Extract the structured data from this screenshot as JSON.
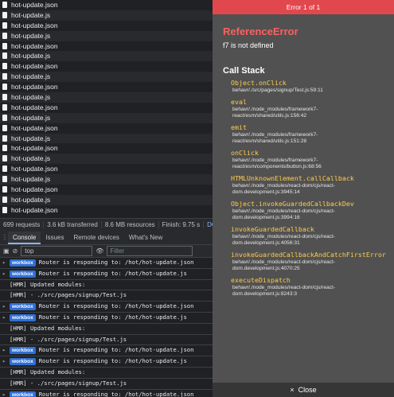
{
  "network": {
    "rows": [
      "hot-update.json",
      "hot-update.js",
      "hot-update.json",
      "hot-update.js",
      "hot-update.json",
      "hot-update.js",
      "hot-update.json",
      "hot-update.js",
      "hot-update.json",
      "hot-update.js",
      "hot-update.json",
      "hot-update.js",
      "hot-update.json",
      "hot-update.js",
      "hot-update.json",
      "hot-update.js",
      "hot-update.json",
      "hot-update.js",
      "hot-update.json",
      "hot-update.js",
      "hot-update.json"
    ],
    "status": {
      "requests": "699 requests",
      "transferred": "3.6 kB transferred",
      "resources": "8.6 MB resources",
      "finish": "Finish: 9.75 s",
      "dom": "DOM"
    }
  },
  "drawer": {
    "tabs": [
      "Console",
      "Issues",
      "Remote devices",
      "What's New"
    ],
    "active_tab": "Console"
  },
  "toolbar": {
    "context": "top",
    "filter_placeholder": "Filter"
  },
  "console": {
    "badge": "workbox",
    "rows": [
      {
        "type": "workbox",
        "text": "Router is responding to: /hot/hot-update.json"
      },
      {
        "type": "workbox",
        "text": "Router is responding to: /hot/hot-update.js"
      },
      {
        "type": "plain",
        "text": "[HMR] Updated modules:"
      },
      {
        "type": "plain",
        "text": "[HMR]  - ./src/pages/signup/Test.js"
      },
      {
        "type": "workbox",
        "text": "Router is responding to: /hot/hot-update.json"
      },
      {
        "type": "workbox",
        "text": "Router is responding to: /hot/hot-update.js"
      },
      {
        "type": "plain",
        "text": "[HMR] Updated modules:"
      },
      {
        "type": "plain",
        "text": "[HMR]  - ./src/pages/signup/Test.js"
      },
      {
        "type": "workbox",
        "text": "Router is responding to: /hot/hot-update.json"
      },
      {
        "type": "workbox",
        "text": "Router is responding to: /hot/hot-update.js"
      },
      {
        "type": "plain",
        "text": "[HMR] Updated modules:"
      },
      {
        "type": "plain",
        "text": "[HMR]  - ./src/pages/signup/Test.js"
      },
      {
        "type": "workbox",
        "text": "Router is responding to: /hot/hot-update.json"
      }
    ]
  },
  "overlay": {
    "header": "Error 1 of 1",
    "error_title": "ReferenceError",
    "error_message": "f7 is not defined",
    "call_stack_title": "Call Stack",
    "frames": [
      {
        "fn": "Object.onClick",
        "loc": "behavr/./src/pages/signup/Test.js:59:11"
      },
      {
        "fn": "eval",
        "loc": "behavr/./node_modules/framework7-react/esm/shared/utils.js:156:42"
      },
      {
        "fn": "emit",
        "loc": "behavr/./node_modules/framework7-react/esm/shared/utils.js:151:28"
      },
      {
        "fn": "onClick",
        "loc": "behavr/./node_modules/framework7-react/esm/components/button.js:68:56"
      },
      {
        "fn": "HTMLUnknownElement.callCallback",
        "loc": "behavr/./node_modules/react-dom/cjs/react-dom.development.js:3945:14"
      },
      {
        "fn": "Object.invokeGuardedCallbackDev",
        "loc": "behavr/./node_modules/react-dom/cjs/react-dom.development.js:3994:16"
      },
      {
        "fn": "invokeGuardedCallback",
        "loc": "behavr/./node_modules/react-dom/cjs/react-dom.development.js:4056:31"
      },
      {
        "fn": "invokeGuardedCallbackAndCatchFirstError",
        "loc": "behavr/./node_modules/react-dom/cjs/react-dom.development.js:4070:25"
      },
      {
        "fn": "executeDispatch",
        "loc": "behavr/./node_modules/react-dom/cjs/react-dom.development.js:8243:3"
      }
    ],
    "close_label": "Close",
    "close_icon": "×"
  },
  "icons": {
    "caret": "▸",
    "block_icon": "⊘",
    "eye_icon": "👁",
    "menu_icon": "⋮",
    "sidebar_icon": "▣"
  },
  "colors": {
    "overlay_header": "#e1484e",
    "error_title": "#ff5f5f",
    "frame_name": "#ffcc4d",
    "workbox_badge": "#2f6fd6"
  }
}
